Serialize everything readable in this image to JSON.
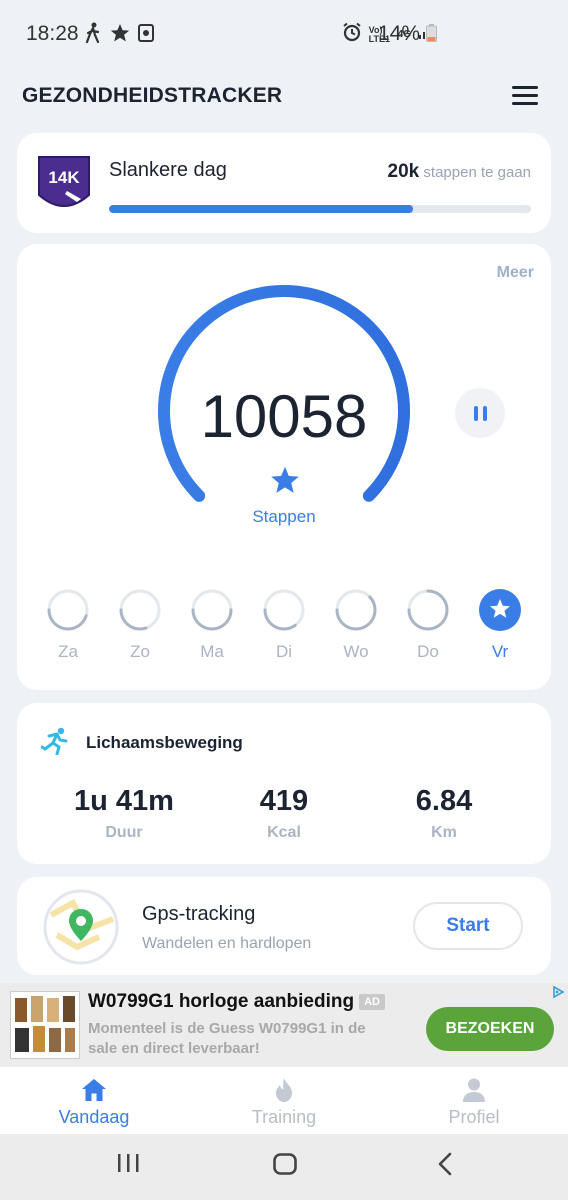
{
  "status_bar": {
    "time": "18:28",
    "battery": "14%",
    "left_icons": [
      "walking-icon",
      "star-icon",
      "camera-notification-icon"
    ],
    "right_icons": [
      "alarm-icon",
      "volte-icon",
      "4g-icon",
      "signal-icon",
      "battery-icon"
    ],
    "volte_label": "Vo) LTE1",
    "net_label": "4G"
  },
  "header": {
    "title": "GEZONDHEIDSTRACKER",
    "menu_icon": "hamburger-icon"
  },
  "goal": {
    "badge_text": "14K",
    "title": "Slankere dag",
    "remaining_value": "20k",
    "remaining_text": "stappen te gaan",
    "progress": 0.72
  },
  "steps": {
    "more_label": "Meer",
    "count": "10058",
    "label": "Stappen",
    "gauge_fraction": 1.0,
    "days": [
      {
        "label": "Za",
        "progress": 0.45,
        "active": false
      },
      {
        "label": "Zo",
        "progress": 0.3,
        "active": false
      },
      {
        "label": "Ma",
        "progress": 0.5,
        "active": false
      },
      {
        "label": "Di",
        "progress": 0.35,
        "active": false
      },
      {
        "label": "Wo",
        "progress": 0.62,
        "active": false
      },
      {
        "label": "Do",
        "progress": 0.75,
        "active": false
      },
      {
        "label": "Vr",
        "progress": 1.0,
        "active": true
      }
    ]
  },
  "activity": {
    "title": "Lichaamsbeweging",
    "metrics": [
      {
        "value": "1u 41m",
        "label": "Duur"
      },
      {
        "value": "419",
        "label": "Kcal"
      },
      {
        "value": "6.84",
        "label": "Km"
      }
    ]
  },
  "gps": {
    "title": "Gps-tracking",
    "subtitle": "Wandelen en hardlopen",
    "button": "Start"
  },
  "ad": {
    "title": "W0799G1 horloge aanbieding",
    "badge": "AD",
    "description": "Momenteel is de Guess W0799G1 in de sale en direct leverbaar!",
    "button": "BEZOEKEN"
  },
  "tabs": [
    {
      "label": "Vandaag",
      "icon": "home-icon",
      "active": true
    },
    {
      "label": "Training",
      "icon": "flame-icon",
      "active": false
    },
    {
      "label": "Profiel",
      "icon": "person-icon",
      "active": false
    }
  ],
  "colors": {
    "accent": "#3a7de6",
    "track": "#e4e7ec",
    "muted": "#aab4c2",
    "ad_button": "#5aa43b"
  }
}
